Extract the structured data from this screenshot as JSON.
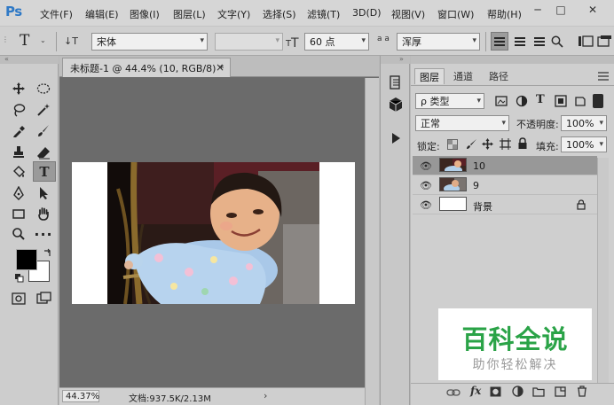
{
  "app": {
    "logo": "Ps"
  },
  "menubar": {
    "items": [
      "文件(F)",
      "编辑(E)",
      "图像(I)",
      "图层(L)",
      "文字(Y)",
      "选择(S)",
      "滤镜(T)",
      "3D(D)",
      "视图(V)",
      "窗口(W)",
      "帮助(H)"
    ],
    "controls": {
      "minimize": "─",
      "maximize": "□",
      "close": "✕"
    }
  },
  "options": {
    "tool_icon": "T",
    "font_family": "宋体",
    "font_style": "",
    "font_size": "60 点",
    "aa_label": "a a",
    "antialias": "浑厚"
  },
  "document": {
    "tab_title": "未标题-1 @ 44.4% (10, RGB/8) *",
    "tab_close": "×",
    "zoom": "44.37%",
    "doc_info": "文档:937.5K/2.13M",
    "status_arrow": "›"
  },
  "layers_panel": {
    "tabs": [
      "图层",
      "通道",
      "路径"
    ],
    "filter_kind": "ρ 类型",
    "blend_mode": "正常",
    "opacity_label": "不透明度:",
    "opacity": "100%",
    "lock_label": "锁定:",
    "fill_label": "填充:",
    "fill": "100%",
    "layers": [
      {
        "name": "10",
        "selected": true
      },
      {
        "name": "9",
        "selected": false
      },
      {
        "name": "背景",
        "selected": false,
        "locked": true
      }
    ],
    "bottom_icons": [
      "link-icon",
      "fx-icon",
      "mask-icon",
      "adjustment-icon",
      "group-icon",
      "new-layer-icon",
      "trash-icon"
    ],
    "fx_label": "fx"
  },
  "watermark": {
    "title": "百科全说",
    "subtitle": "助你轻松解决"
  },
  "colors": {
    "foreground": "#000000",
    "background": "#ffffff",
    "watermark_green": "#2aa347",
    "ps_blue": "#2f79c6"
  }
}
